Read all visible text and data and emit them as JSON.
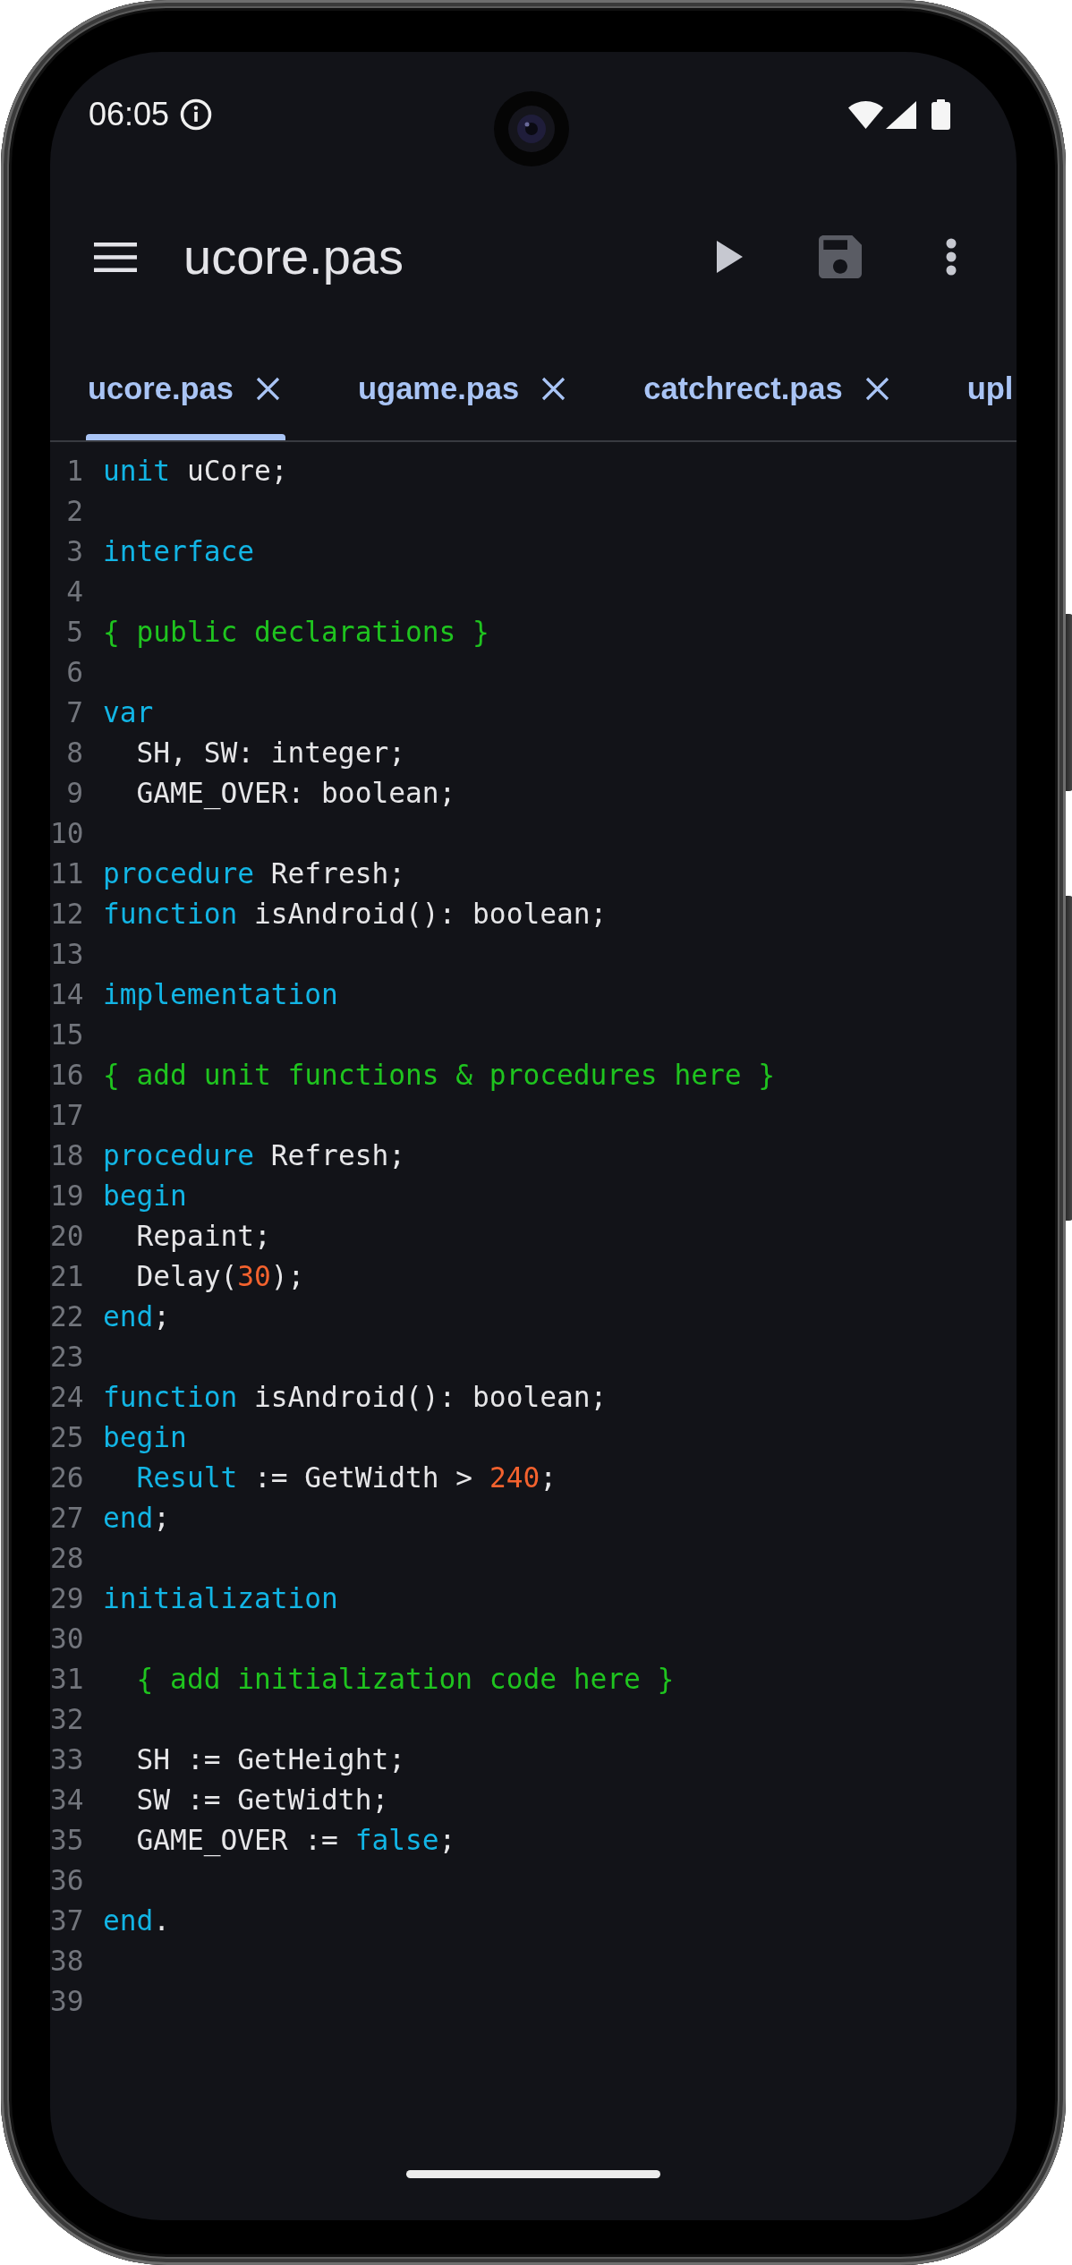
{
  "status_bar": {
    "time": "06:05"
  },
  "toolbar": {
    "title": "ucore.pas",
    "actions": [
      {
        "kind": "run",
        "disabled": false
      },
      {
        "kind": "save",
        "disabled": true
      },
      {
        "kind": "more",
        "disabled": false
      }
    ]
  },
  "tabs": [
    {
      "label": "ucore.pas",
      "selected": true,
      "clipped": false
    },
    {
      "label": "ugame.pas",
      "selected": false,
      "clipped": false
    },
    {
      "label": "catchrect.pas",
      "selected": false,
      "clipped": false
    },
    {
      "label": "upl",
      "selected": false,
      "clipped": true
    }
  ],
  "editor": {
    "lines": [
      {
        "number": "1",
        "tokens": [
          {
            "kind": "keyword",
            "text": "unit"
          },
          {
            "kind": "plain",
            "text": " uCore;"
          }
        ]
      },
      {
        "number": "2"
      },
      {
        "number": "3",
        "tokens": [
          {
            "kind": "keyword",
            "text": "interface"
          }
        ]
      },
      {
        "number": "4"
      },
      {
        "number": "5",
        "tokens": [
          {
            "kind": "comment",
            "text": "{ public declarations }"
          }
        ]
      },
      {
        "number": "6"
      },
      {
        "number": "7",
        "tokens": [
          {
            "kind": "keyword",
            "text": "var"
          }
        ]
      },
      {
        "number": "8",
        "tokens": [
          {
            "kind": "plain",
            "text": "  SH, SW: integer;"
          }
        ]
      },
      {
        "number": "9",
        "tokens": [
          {
            "kind": "plain",
            "text": "  GAME_OVER: boolean;"
          }
        ]
      },
      {
        "number": "10"
      },
      {
        "number": "11",
        "tokens": [
          {
            "kind": "keyword",
            "text": "procedure"
          },
          {
            "kind": "plain",
            "text": " Refresh;"
          }
        ]
      },
      {
        "number": "12",
        "tokens": [
          {
            "kind": "keyword",
            "text": "function"
          },
          {
            "kind": "plain",
            "text": " isAndroid(): boolean;"
          }
        ]
      },
      {
        "number": "13"
      },
      {
        "number": "14",
        "tokens": [
          {
            "kind": "keyword",
            "text": "implementation"
          }
        ]
      },
      {
        "number": "15"
      },
      {
        "number": "16",
        "tokens": [
          {
            "kind": "comment",
            "text": "{ add unit functions & procedures here }"
          }
        ]
      },
      {
        "number": "17"
      },
      {
        "number": "18",
        "tokens": [
          {
            "kind": "keyword",
            "text": "procedure"
          },
          {
            "kind": "plain",
            "text": " Refresh;"
          }
        ]
      },
      {
        "number": "19",
        "tokens": [
          {
            "kind": "keyword",
            "text": "begin"
          }
        ]
      },
      {
        "number": "20",
        "tokens": [
          {
            "kind": "plain",
            "text": "  Repaint;"
          }
        ]
      },
      {
        "number": "21",
        "tokens": [
          {
            "kind": "plain",
            "text": "  Delay("
          },
          {
            "kind": "number",
            "text": "30"
          },
          {
            "kind": "plain",
            "text": ");"
          }
        ]
      },
      {
        "number": "22",
        "tokens": [
          {
            "kind": "keyword",
            "text": "end"
          },
          {
            "kind": "plain",
            "text": ";"
          }
        ]
      },
      {
        "number": "23"
      },
      {
        "number": "24",
        "tokens": [
          {
            "kind": "keyword",
            "text": "function"
          },
          {
            "kind": "plain",
            "text": " isAndroid(): boolean;"
          }
        ]
      },
      {
        "number": "25",
        "tokens": [
          {
            "kind": "keyword",
            "text": "begin"
          }
        ]
      },
      {
        "number": "26",
        "tokens": [
          {
            "kind": "keyword",
            "text": "  Result"
          },
          {
            "kind": "plain",
            "text": " := GetWidth > "
          },
          {
            "kind": "number",
            "text": "240"
          },
          {
            "kind": "plain",
            "text": ";"
          }
        ]
      },
      {
        "number": "27",
        "tokens": [
          {
            "kind": "keyword",
            "text": "end"
          },
          {
            "kind": "plain",
            "text": ";"
          }
        ]
      },
      {
        "number": "28"
      },
      {
        "number": "29",
        "tokens": [
          {
            "kind": "keyword",
            "text": "initialization"
          }
        ]
      },
      {
        "number": "30"
      },
      {
        "number": "31",
        "tokens": [
          {
            "kind": "comment",
            "text": "  { add initialization code here }"
          }
        ]
      },
      {
        "number": "32"
      },
      {
        "number": "33",
        "tokens": [
          {
            "kind": "plain",
            "text": "  SH := GetHeight;"
          }
        ]
      },
      {
        "number": "34",
        "tokens": [
          {
            "kind": "plain",
            "text": "  SW := GetWidth;"
          }
        ]
      },
      {
        "number": "35",
        "tokens": [
          {
            "kind": "plain",
            "text": "  GAME_OVER := "
          },
          {
            "kind": "keyword",
            "text": "false"
          },
          {
            "kind": "plain",
            "text": ";"
          }
        ]
      },
      {
        "number": "36"
      },
      {
        "number": "37",
        "tokens": [
          {
            "kind": "keyword",
            "text": "end"
          },
          {
            "kind": "plain",
            "text": "."
          }
        ]
      },
      {
        "number": "38"
      },
      {
        "number": "39"
      }
    ]
  }
}
